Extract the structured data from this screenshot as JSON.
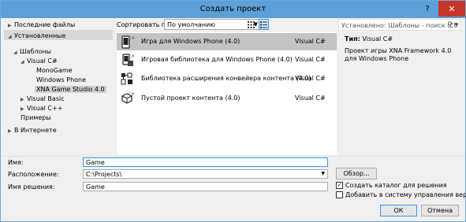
{
  "window": {
    "title": "Создать проект",
    "help_icon": "?",
    "close_icon": "✕"
  },
  "tree": {
    "recent": "Последние файлы",
    "installed": "Установленные",
    "templates": "Шаблоны",
    "visual_csharp": "Visual C#",
    "monogame": "MonoGame",
    "windows_phone": "Windows Phone",
    "xna": "XNA Game Studio 4.0",
    "visual_basic": "Visual Basic",
    "visual_cpp": "Visual C++",
    "samples": "Примеры",
    "online": "В Интернете"
  },
  "toolbar": {
    "sort_label": "Сортировать по:",
    "sort_value": "По умолчанию"
  },
  "search": {
    "text": "Установлено: Шаблоны - поиск (Ctrl+E)"
  },
  "templates": [
    {
      "name": "Игра для Windows Phone (4.0)",
      "lang": "Visual C#",
      "icon": "phone-game-icon"
    },
    {
      "name": "Игровая библиотека для Windows Phone (4.0)",
      "lang": "Visual C#",
      "icon": "phone-library-icon"
    },
    {
      "name": "Библиотека расширения конвейера контента (4.0)",
      "lang": "Visual C#",
      "icon": "pipeline-extension-icon"
    },
    {
      "name": "Пустой проект контента (4.0)",
      "lang": "Visual C#",
      "icon": "content-project-icon"
    }
  ],
  "details": {
    "type_label": "Тип:",
    "type_value": "Visual C#",
    "description": "Проект игры XNA Framework 4.0 для Windows Phone"
  },
  "form": {
    "name_label": "Имя:",
    "name_value": "Game",
    "location_label": "Расположение:",
    "location_value": "C:\\Projects\\",
    "solution_label": "Имя решения:",
    "solution_value": "Game",
    "browse_label": "Обзор...",
    "create_dir_label": "Создать каталог для решения",
    "create_dir_checked": true,
    "add_vcs_label": "Добавить в систему управления версиями",
    "add_vcs_checked": false,
    "ok_label": "ОК",
    "cancel_label": "Отмена"
  },
  "colors": {
    "titlebar": "#5ba0d8",
    "close": "#c7352b",
    "selection": "#c3c3c3"
  }
}
